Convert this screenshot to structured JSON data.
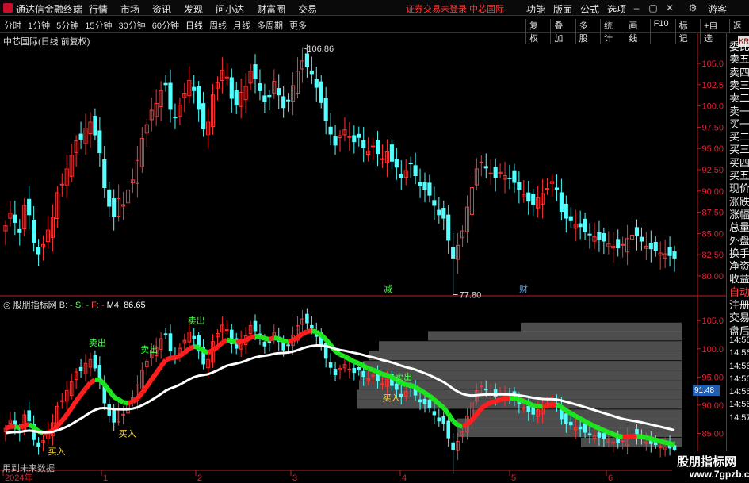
{
  "titlebar": {
    "app_name": "通达信金融终端",
    "menu": [
      "行情",
      "市场",
      "资讯",
      "发现",
      "问小达",
      "财富圈",
      "交易"
    ],
    "notice": "证券交易未登录  中芯国际",
    "right_menu": [
      "功能",
      "版面",
      "公式",
      "选项"
    ],
    "guest": "游客"
  },
  "periodbar": {
    "periods": [
      "分时",
      "1分钟",
      "5分钟",
      "15分钟",
      "30分钟",
      "60分钟",
      "日线",
      "周线",
      "月线",
      "多周期",
      "更多"
    ],
    "active": "日线",
    "tools": [
      "复权",
      "叠加",
      "多股",
      "统计",
      "画线",
      "F10",
      "标记",
      "+自选",
      "返回"
    ]
  },
  "main_chart": {
    "title": "中芯国际(日线 前复权)",
    "high_label": "106.86",
    "low_label": "77.80",
    "markers": [
      "减",
      "财"
    ],
    "y_ticks": [
      "105.0",
      "102.5",
      "100.0",
      "97.50",
      "95.00",
      "92.50",
      "90.00",
      "87.50",
      "85.00",
      "82.50",
      "80.00"
    ]
  },
  "indicator": {
    "title": "股朋指标网",
    "b": "B: -",
    "s": "S: -",
    "f": "F: -",
    "m4": "M4: 86.65",
    "y_ticks": [
      "105.0",
      "100.0",
      "95.00",
      "90.00",
      "85.00"
    ],
    "value_tag": "91.48",
    "sell_label": "卖出",
    "buy_label": "买入"
  },
  "x_axis": {
    "labels": [
      "2024年",
      "1",
      "2",
      "3",
      "4",
      "5",
      "6"
    ]
  },
  "sidepanel": {
    "labels": [
      "委比",
      "卖五",
      "卖四",
      "卖三",
      "卖二",
      "卖一",
      "买一",
      "买二",
      "买三",
      "买四",
      "买五",
      "现价",
      "涨跌",
      "涨幅",
      "总量",
      "外盘",
      "换手",
      "净资",
      "收益",
      "自动",
      "注册",
      "交易",
      "盘后",
      "14:56",
      "14:56",
      "14:56",
      "14:56",
      "14:56",
      "14:56",
      "14:57"
    ],
    "badge": "KR"
  },
  "footer": {
    "future_note": "用到未来数据"
  },
  "watermark": {
    "line1": "股朋指标网",
    "line2": "www.7gpzb.com"
  },
  "chart_data": [
    {
      "type": "candlestick",
      "title": "中芯国际(日线 前复权)",
      "y_range": [
        77.8,
        106.86
      ],
      "annotations": [
        {
          "label": "106.86",
          "kind": "high"
        },
        {
          "label": "77.80",
          "kind": "low"
        }
      ],
      "up_color": "#ff3232",
      "down_color": "#54ffff",
      "closes": [
        85.9,
        87.4,
        86.3,
        85.1,
        88.3,
        87.2,
        83.9,
        82.6,
        83.7,
        85.4,
        86.9,
        89.8,
        90.8,
        92.6,
        94.2,
        95.9,
        96.1,
        97.4,
        98.1,
        96.6,
        94.5,
        90.4,
        88.2,
        87.0,
        89.1,
        88.4,
        90.1,
        91.3,
        93.6,
        96.2,
        97.8,
        99.5,
        100.3,
        101.8,
        102.5,
        99.6,
        98.7,
        100.1,
        101.5,
        103.0,
        101.8,
        99.6,
        97.3,
        98.1,
        101.3,
        102.7,
        104.2,
        103.4,
        100.9,
        100.1,
        101.6,
        102.3,
        104.1,
        103.2,
        101.8,
        100.5,
        101.1,
        102.9,
        101.3,
        99.8,
        100.6,
        102.4,
        104.1,
        105.3,
        104.6,
        103.8,
        102.2,
        100.4,
        98.3,
        96.7,
        95.4,
        96.5,
        97.2,
        96.4,
        95.8,
        96.3,
        95.1,
        94.7,
        95.3,
        94.4,
        93.8,
        94.6,
        93.5,
        92.8,
        91.6,
        92.4,
        93.2,
        91.8,
        90.6,
        90.2,
        89.5,
        88.3,
        87.2,
        86.8,
        84.2,
        82.1,
        83.6,
        85.3,
        88.1,
        90.4,
        92.6,
        93.4,
        92.7,
        92.1,
        91.6,
        92.2,
        91.8,
        91.5,
        91.0,
        90.2,
        89.6,
        88.8,
        88.4,
        89.2,
        89.7,
        90.3,
        91.1,
        90.2,
        87.6,
        86.8,
        86.5,
        86.1,
        85.8,
        85.2,
        84.9,
        84.6,
        84.3,
        84.1,
        83.8,
        83.5,
        83.3,
        83.7,
        84.4,
        84.8,
        84.7,
        84.1,
        83.5,
        83.2,
        83.0,
        82.7,
        82.6,
        82.4,
        82.1
      ]
    },
    {
      "type": "line",
      "title": "股朋指标网",
      "series": [
        {
          "name": "M4",
          "last_value": 86.65
        }
      ],
      "value_tag": 91.48,
      "y_ticks": [
        105.0,
        100.0,
        95.0,
        90.0,
        85.0
      ]
    }
  ]
}
